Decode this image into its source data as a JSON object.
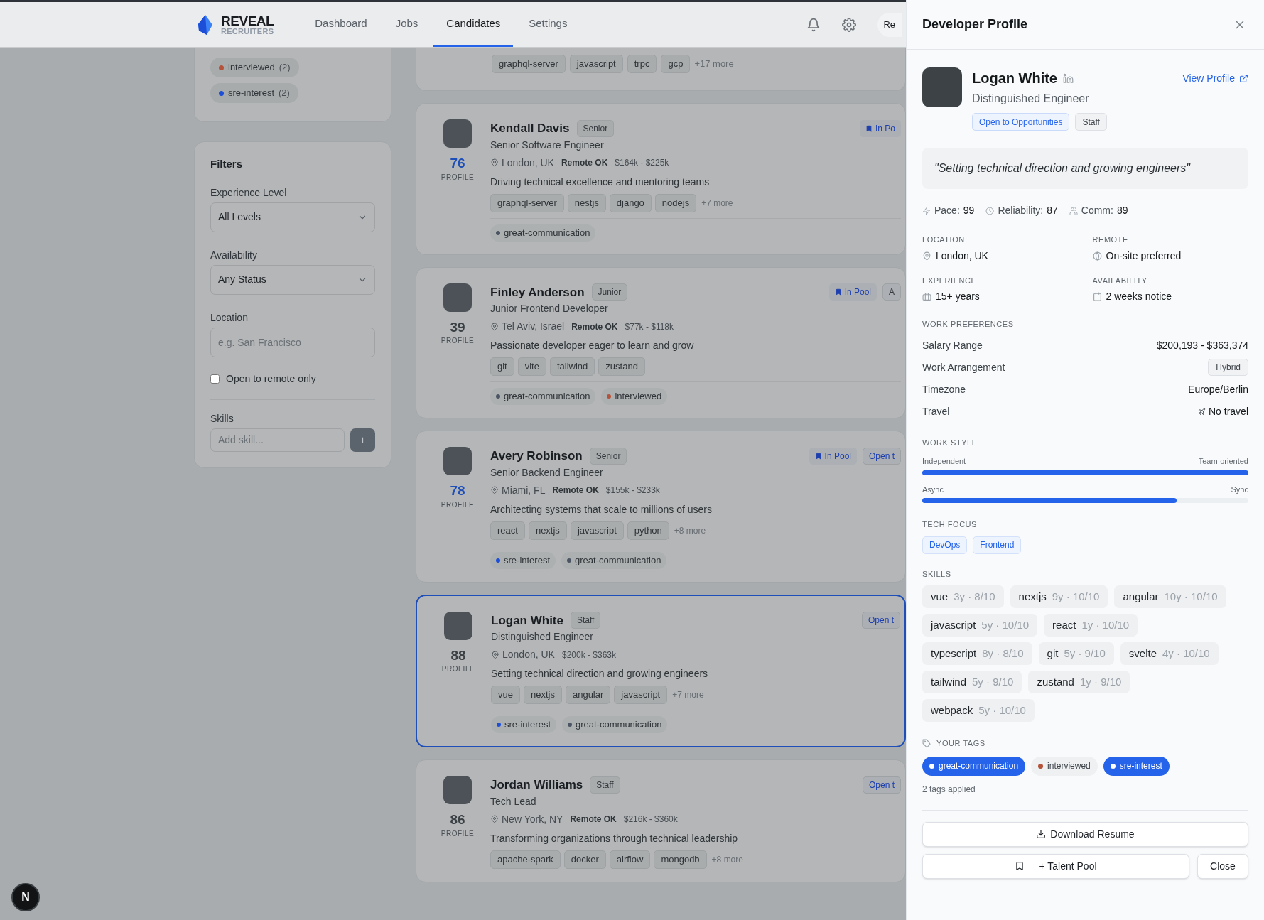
{
  "nav": {
    "logo_title": "REVEAL",
    "logo_subtitle": "RECRUITERS",
    "links": [
      {
        "label": "Dashboard",
        "selected": false
      },
      {
        "label": "Jobs",
        "selected": false
      },
      {
        "label": "Candidates",
        "selected": true
      },
      {
        "label": "Settings",
        "selected": false
      }
    ],
    "user_button": "Re"
  },
  "tag_summary": [
    {
      "label": "interviewed",
      "count": "(2)",
      "color": "#b4533a"
    },
    {
      "label": "sre-interest",
      "count": "(2)",
      "color": "#1d4ed8"
    }
  ],
  "filters": {
    "title": "Filters",
    "experience": {
      "label": "Experience Level",
      "value": "All Levels"
    },
    "availability": {
      "label": "Availability",
      "value": "Any Status"
    },
    "location": {
      "label": "Location",
      "placeholder": "e.g. San Francisco"
    },
    "remote_only": {
      "label": "Open to remote only",
      "checked": false
    },
    "skills": {
      "label": "Skills",
      "placeholder": "Add skill...",
      "add": "+"
    }
  },
  "partial_card": {
    "skills": [
      "graphql-server",
      "javascript",
      "trpc",
      "gcp"
    ],
    "more": "+17 more"
  },
  "candidates": [
    {
      "name": "Kendall Davis",
      "level": "Senior",
      "title": "Senior Software Engineer",
      "location": "London, UK",
      "remote": "Remote OK",
      "salary": "$164k - $225k",
      "bio": "Driving technical excellence and mentoring teams",
      "skills": [
        "graphql-server",
        "nestjs",
        "django",
        "nodejs"
      ],
      "more": "+7 more",
      "tags": [
        {
          "label": "great-communication",
          "color": "#4b5563"
        }
      ],
      "score": "76",
      "score_label": "PROFILE",
      "color": "#1e4fb8",
      "badges": [
        {
          "label": "In Po",
          "kind": "pool"
        }
      ],
      "selected": false
    },
    {
      "name": "Finley Anderson",
      "level": "Junior",
      "title": "Junior Frontend Developer",
      "location": "Tel Aviv, Israel",
      "remote": "Remote OK",
      "salary": "$77k - $118k",
      "bio": "Passionate developer eager to learn and grow",
      "skills": [
        "git",
        "vite",
        "tailwind",
        "zustand"
      ],
      "tags": [
        {
          "label": "great-communication",
          "color": "#4b5563"
        },
        {
          "label": "interviewed",
          "color": "#b4533a"
        }
      ],
      "score": "39",
      "score_label": "PROFILE",
      "color": "#3b4045",
      "badges": [
        {
          "label": "In Pool",
          "kind": "pool"
        },
        {
          "label": "A",
          "kind": "plain"
        }
      ],
      "selected": false
    },
    {
      "name": "Avery Robinson",
      "level": "Senior",
      "title": "Senior Backend Engineer",
      "location": "Miami, FL",
      "remote": "Remote OK",
      "salary": "$155k - $233k",
      "bio": "Architecting systems that scale to millions of users",
      "skills": [
        "react",
        "nextjs",
        "javascript",
        "python"
      ],
      "more": "+8 more",
      "tags": [
        {
          "label": "sre-interest",
          "color": "#1d4ed8"
        },
        {
          "label": "great-communication",
          "color": "#4b5563"
        }
      ],
      "score": "78",
      "score_label": "PROFILE",
      "color": "#1e4fb8",
      "badges": [
        {
          "label": "In Pool",
          "kind": "pool"
        },
        {
          "label": "Open t",
          "kind": "open"
        }
      ],
      "selected": false
    },
    {
      "name": "Logan White",
      "level": "Staff",
      "title": "Distinguished Engineer",
      "location": "London, UK",
      "salary": "$200k - $363k",
      "bio": "Setting technical direction and growing engineers",
      "skills": [
        "vue",
        "nextjs",
        "angular",
        "javascript"
      ],
      "more": "+7 more",
      "tags": [
        {
          "label": "sre-interest",
          "color": "#1d4ed8"
        },
        {
          "label": "great-communication",
          "color": "#4b5563"
        }
      ],
      "score": "88",
      "score_label": "PROFILE",
      "color": "#3b4045",
      "badges": [
        {
          "label": "Open t",
          "kind": "open"
        }
      ],
      "selected": true
    },
    {
      "name": "Jordan Williams",
      "level": "Staff",
      "title": "Tech Lead",
      "location": "New York, NY",
      "remote": "Remote OK",
      "salary": "$216k - $360k",
      "bio": "Transforming organizations through technical leadership",
      "skills": [
        "apache-spark",
        "docker",
        "airflow",
        "mongodb"
      ],
      "more": "+8 more",
      "score": "86",
      "score_label": "PROFILE",
      "color": "#3b4045",
      "badges": [
        {
          "label": "Open t",
          "kind": "open"
        }
      ],
      "selected": false
    }
  ],
  "panel": {
    "title": "Developer Profile",
    "name": "Logan White",
    "headline": "Distinguished Engineer",
    "badges": [
      {
        "label": "Open to Opportunities",
        "kind": "open"
      },
      {
        "label": "Staff",
        "kind": "plain"
      }
    ],
    "view_profile": "View Profile",
    "quote": "\"Setting technical direction and growing engineers\"",
    "stats": [
      {
        "label": "Pace:",
        "value": "99"
      },
      {
        "label": "Reliability:",
        "value": "87"
      },
      {
        "label": "Comm:",
        "value": "89"
      }
    ],
    "info": [
      {
        "label": "LOCATION",
        "value": "London, UK"
      },
      {
        "label": "REMOTE",
        "value": "On-site preferred"
      },
      {
        "label": "EXPERIENCE",
        "value": "15+ years"
      },
      {
        "label": "AVAILABILITY",
        "value": "2 weeks notice"
      }
    ],
    "work_preferences": {
      "title": "WORK PREFERENCES",
      "rows": [
        {
          "label": "Salary Range",
          "value": "$200,193 - $363,374",
          "kind": "strong"
        },
        {
          "label": "Work Arrangement",
          "value": "Hybrid",
          "kind": "pill"
        },
        {
          "label": "Timezone",
          "value": "Europe/Berlin",
          "kind": "text"
        },
        {
          "label": "Travel",
          "value": "No travel",
          "kind": "travel"
        }
      ]
    },
    "work_style": {
      "title": "WORK STYLE",
      "sliders": [
        {
          "left": "Independent",
          "right": "Team-oriented",
          "level": 1.0
        },
        {
          "left": "Async",
          "right": "Sync",
          "level": 0.78
        }
      ]
    },
    "tech_focus": {
      "title": "TECH FOCUS",
      "items": [
        "DevOps",
        "Frontend"
      ]
    },
    "skills": {
      "title": "SKILLS",
      "items": [
        {
          "name": "vue",
          "detail": "3y · 8/10"
        },
        {
          "name": "nextjs",
          "detail": "9y · 10/10"
        },
        {
          "name": "angular",
          "detail": "10y · 10/10"
        },
        {
          "name": "javascript",
          "detail": "5y · 10/10"
        },
        {
          "name": "react",
          "detail": "1y · 10/10"
        },
        {
          "name": "typescript",
          "detail": "8y · 8/10"
        },
        {
          "name": "git",
          "detail": "5y · 9/10"
        },
        {
          "name": "svelte",
          "detail": "4y · 10/10"
        },
        {
          "name": "tailwind",
          "detail": "5y · 9/10"
        },
        {
          "name": "zustand",
          "detail": "1y · 9/10"
        },
        {
          "name": "webpack",
          "detail": "5y · 10/10"
        }
      ]
    },
    "your_tags": {
      "title": "YOUR TAGS",
      "tags": [
        {
          "label": "great-communication",
          "selected": true
        },
        {
          "label": "interviewed",
          "selected": false,
          "color": "#b4533a"
        },
        {
          "label": "sre-interest",
          "selected": true
        }
      ],
      "applied": "2 tags applied"
    },
    "download": "Download Resume",
    "talent_pool": "+ Talent Pool",
    "close": "Close"
  },
  "dev_badge": "N"
}
